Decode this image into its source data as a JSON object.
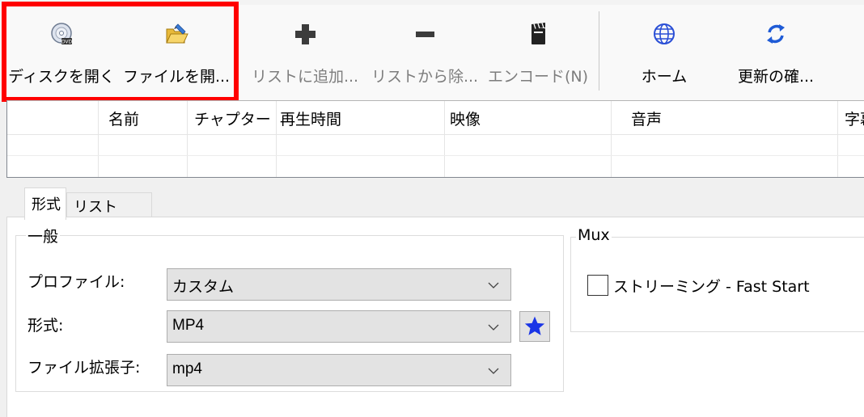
{
  "toolbar": {
    "open_disc": "ディスクを開く",
    "open_file": "ファイルを開...",
    "add_to_list": "リストに追加...",
    "remove_from_list": "リストから除...",
    "encode": "エンコード(N)",
    "home": "ホーム",
    "check_updates": "更新の確..."
  },
  "icons": {
    "open_disc": "disc-icon",
    "open_file": "folder-open-icon",
    "add_to_list": "plus-icon",
    "remove_from_list": "minus-icon",
    "encode": "clapperboard-icon",
    "home": "globe-icon",
    "check_updates": "refresh-icon"
  },
  "titles_table": {
    "columns": [
      "名前",
      "チャプター",
      "再生時間",
      "映像",
      "音声",
      "字幕"
    ]
  },
  "tabs": [
    {
      "label": "形式",
      "active": true
    },
    {
      "label": "リスト",
      "active": false
    }
  ],
  "general": {
    "legend": "一般",
    "profile_label": "プロファイル:",
    "profile_value": "カスタム",
    "format_label": "形式:",
    "format_value": "MP4",
    "extension_label": "ファイル拡張子:",
    "extension_value": "mp4"
  },
  "mux": {
    "legend": "Mux",
    "streaming_label": "ストリーミング - Fast Start",
    "streaming_checked": false
  },
  "colors": {
    "highlight": "#ff0000",
    "star": "#1a35e6",
    "refresh": "#1f5bd6",
    "globe": "#2a4fd6"
  }
}
